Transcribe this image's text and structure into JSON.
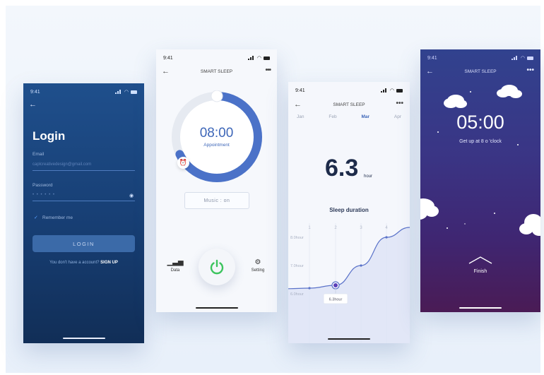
{
  "status_time": "9:41",
  "login": {
    "back_icon": "arrow-left-icon",
    "title": "Login",
    "email_label": "Email",
    "email_value": "caplcreativedesign@gmail.com",
    "password_label": "Password",
    "password_mask": "• • • • • •",
    "remember_label": "Remember me",
    "login_button": "LOGIN",
    "signup_prompt": "You don't have a account?",
    "signup_link": "SIGN UP"
  },
  "alarm": {
    "app_title": "SMART SLEEP",
    "more": "•••",
    "time": "08:00",
    "subtitle": "Appointment",
    "music_label": "Music : on",
    "data_label": "Data",
    "setting_label": "Setting",
    "ring_progress": 0.68,
    "colors": {
      "accent": "#3d66b8",
      "power": "#3cc45e"
    }
  },
  "stats": {
    "app_title": "SMART SLEEP",
    "more": "•••",
    "months": [
      {
        "label": "Jan",
        "active": false
      },
      {
        "label": "Feb",
        "active": false
      },
      {
        "label": "Mar",
        "active": true
      },
      {
        "label": "Apr",
        "active": false
      }
    ],
    "value": "6.3",
    "unit": "hour",
    "chart_title": "Sleep duration",
    "tooltip": "6.3hour"
  },
  "chart_data": {
    "type": "area",
    "title": "Sleep duration",
    "x": [
      1,
      2,
      3,
      4
    ],
    "x_ticks": [
      "1",
      "2",
      "3",
      "4"
    ],
    "y_ticks": [
      "6.0hour",
      "7.0hour",
      "8.0hour"
    ],
    "series": [
      {
        "values": [
          6.2,
          6.3,
          7.0,
          8.0
        ]
      }
    ],
    "highlight": {
      "x": 2,
      "label": "6.3hour"
    },
    "ylim": [
      5.5,
      8.5
    ],
    "grid": true,
    "colors": {
      "line": "#5b73c9",
      "fill": "#dbe2f6"
    }
  },
  "night": {
    "app_title": "SMART SLEEP",
    "more": "•••",
    "time": "05:00",
    "subtitle": "Get up at 8 o 'clock",
    "finish_label": "Finish"
  }
}
